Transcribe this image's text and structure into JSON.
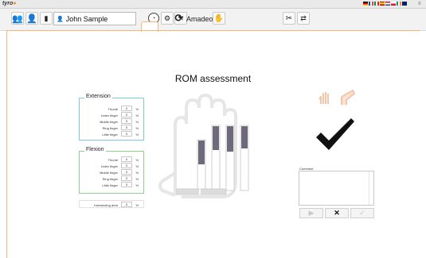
{
  "app": {
    "name": "tyro",
    "window_controls": "≡"
  },
  "toolbar": {
    "user_name": "John Sample",
    "device_name": "Amadeo"
  },
  "page": {
    "title": "ROM assessment"
  },
  "extension": {
    "title": "Extension",
    "rows": [
      {
        "label": "Thumb",
        "value": "0",
        "unit": "%"
      },
      {
        "label": "Index finger",
        "value": "0",
        "unit": "%"
      },
      {
        "label": "Middle finger",
        "value": "0",
        "unit": "%"
      },
      {
        "label": "Ring finger",
        "value": "0",
        "unit": "%"
      },
      {
        "label": "Little finger",
        "value": "0",
        "unit": "%"
      }
    ]
  },
  "flexion": {
    "title": "Flexion",
    "rows": [
      {
        "label": "Thumb",
        "value": "0",
        "unit": "%"
      },
      {
        "label": "Index finger",
        "value": "0",
        "unit": "%"
      },
      {
        "label": "Middle finger",
        "value": "0",
        "unit": "%"
      },
      {
        "label": "Ring finger",
        "value": "0",
        "unit": "%"
      },
      {
        "label": "Little finger",
        "value": "0",
        "unit": "%"
      }
    ]
  },
  "intersecting": {
    "label": "Intersecting area",
    "value": "0",
    "unit": "%"
  },
  "comment": {
    "label": "Comment",
    "value": ""
  },
  "colors": {
    "accent": "#f4b67c",
    "extension_border": "#7ec8e3",
    "flexion_border": "#8fd08f",
    "finger_fill": "#6e6a7c",
    "check": "#111111"
  },
  "icons": {
    "users": "users-icon",
    "user": "user-icon",
    "stats": "chart-icon",
    "refresh": "refresh-icon",
    "tools": "tools-icon"
  }
}
